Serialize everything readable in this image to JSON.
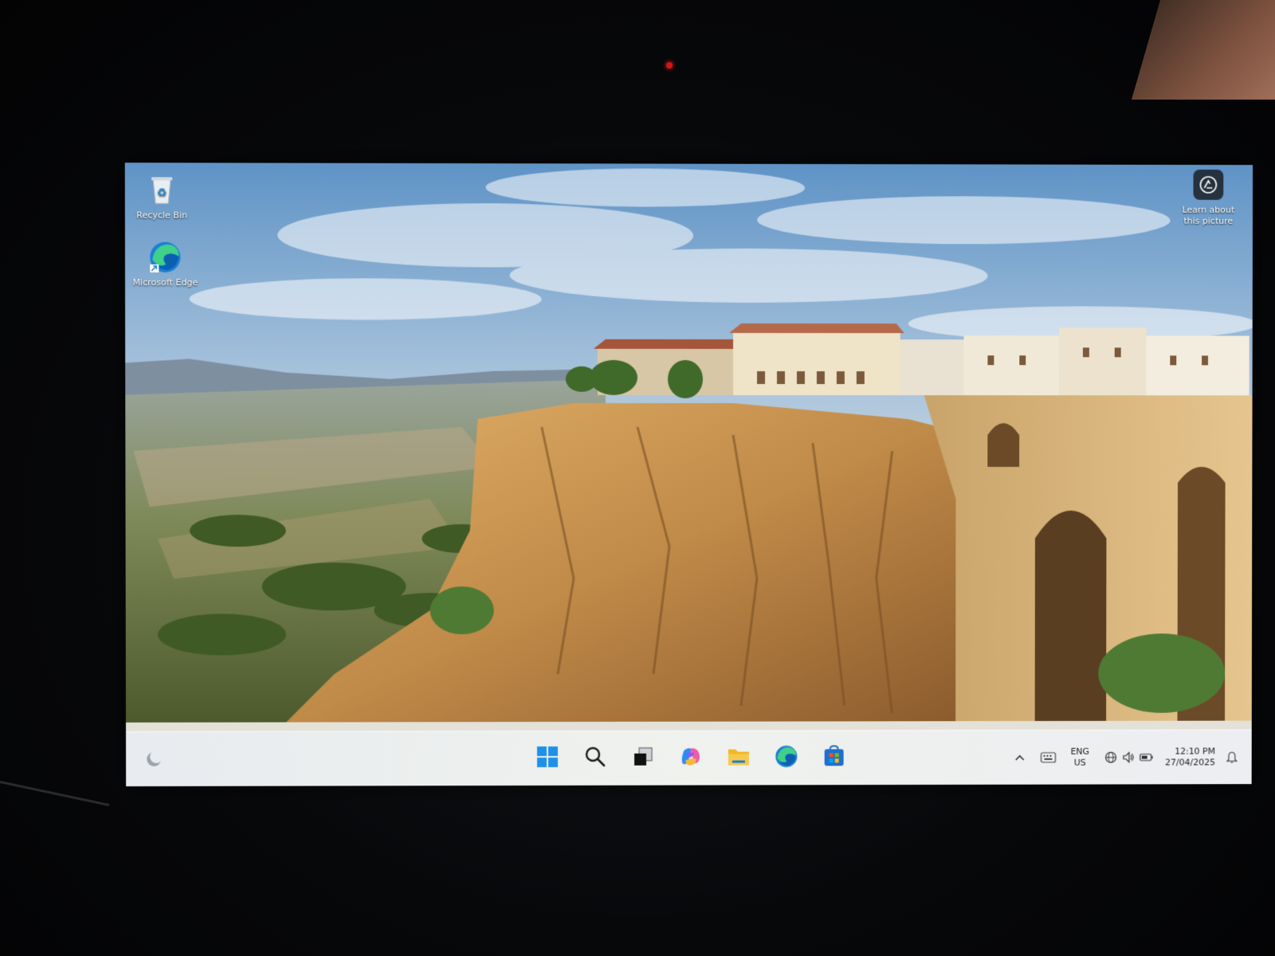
{
  "desktop": {
    "icons": [
      {
        "label": "Recycle Bin",
        "icon": "recycle-bin-icon"
      },
      {
        "label": "Microsoft Edge",
        "icon": "edge-icon"
      }
    ],
    "spotlight": {
      "label_line1": "Learn about",
      "label_line2": "this picture",
      "icon": "camera-aperture-icon"
    }
  },
  "taskbar": {
    "widgets_icon": "weather-widget-icon",
    "pinned": [
      {
        "name": "start",
        "icon": "windows-start-icon"
      },
      {
        "name": "search",
        "icon": "search-icon"
      },
      {
        "name": "task-view",
        "icon": "task-view-icon"
      },
      {
        "name": "copilot",
        "icon": "copilot-icon"
      },
      {
        "name": "file-explorer",
        "icon": "folder-icon"
      },
      {
        "name": "edge",
        "icon": "edge-icon"
      },
      {
        "name": "microsoft-store",
        "icon": "store-icon"
      }
    ],
    "tray": {
      "overflow_icon": "chevron-up-icon",
      "keyboard_icon": "keyboard-icon",
      "language_line1": "ENG",
      "language_line2": "US",
      "network_icon": "globe-network-icon",
      "volume_icon": "speaker-icon",
      "battery_icon": "battery-icon",
      "time": "12:10 PM",
      "date": "27/04/2025",
      "notification_icon": "notification-bell-icon"
    }
  },
  "colors": {
    "taskbar_bg": "#e8ecf0",
    "accent_blue": "#0078d4",
    "sky_top": "#6f9fcf",
    "cliff": "#c8934e"
  }
}
